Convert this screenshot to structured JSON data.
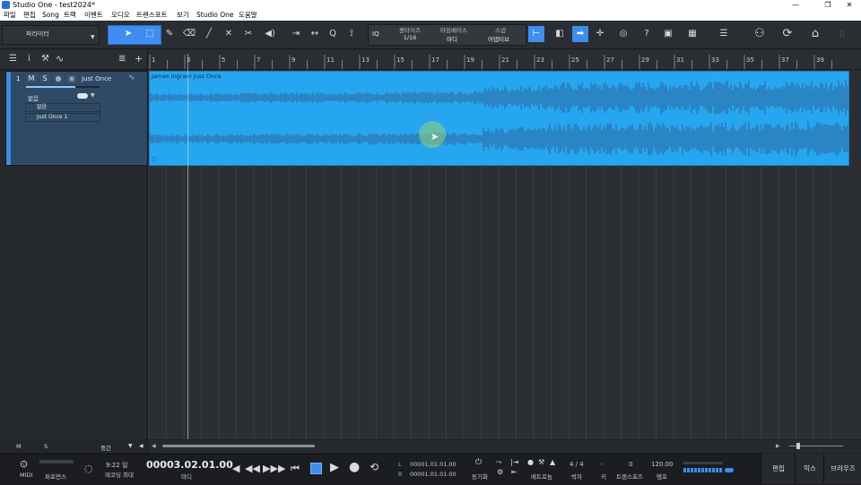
{
  "window": {
    "title": "Studio One - test2024*",
    "controls": [
      "—",
      "❐",
      "✕"
    ]
  },
  "menu": [
    "파일",
    "편집",
    "Song",
    "트랙",
    "이벤트",
    "오디오",
    "트랜스포트",
    "보기",
    "Studio One",
    "도움말"
  ],
  "toolbar": {
    "param_label": "파라미터",
    "iq_label": "IQ",
    "quantize_label": "퀀타이즈",
    "quantize_value": "1/16",
    "timebase_label": "타임베이스",
    "timebase_value": "마디",
    "snap_label": "스냅",
    "snap_value": "어댑티브",
    "help_label": "?"
  },
  "ruler": {
    "marks": [
      "1",
      "3",
      "5",
      "7",
      "9",
      "11",
      "13",
      "15",
      "17",
      "19",
      "21",
      "23",
      "25",
      "27",
      "29",
      "31",
      "33",
      "35",
      "37",
      "39"
    ]
  },
  "track": {
    "number": "1",
    "mute": "M",
    "solo": "S",
    "name": "Just Once",
    "input": "없음",
    "output": "없음",
    "playlist": "Just Once 1"
  },
  "clip": {
    "title": "James Ingram Just Once"
  },
  "bottom_left": {
    "m": "M",
    "s": "S",
    "size": "중간"
  },
  "transport": {
    "midi": "MIDI",
    "performance": "퍼포먼스",
    "record_time": "9:22 일",
    "record_max": "레코딩 최대",
    "position": "00003.02.01.00",
    "position_unit": "마디",
    "left_locator_label": "L",
    "left_locator": "00001.01.01.00",
    "right_locator_label": "R",
    "right_locator": "00001.01.01.00",
    "sync": "동기화",
    "metronome": "메트로놈",
    "timesig": "4 / 4",
    "timesig_label": "박자",
    "key": "-",
    "key_label": "키",
    "transpose": "0",
    "transpose_label": "트랜스포즈",
    "tempo": "120.00",
    "tempo_label": "템포",
    "edit": "편집",
    "mix": "믹스",
    "browse": "브라우즈"
  }
}
